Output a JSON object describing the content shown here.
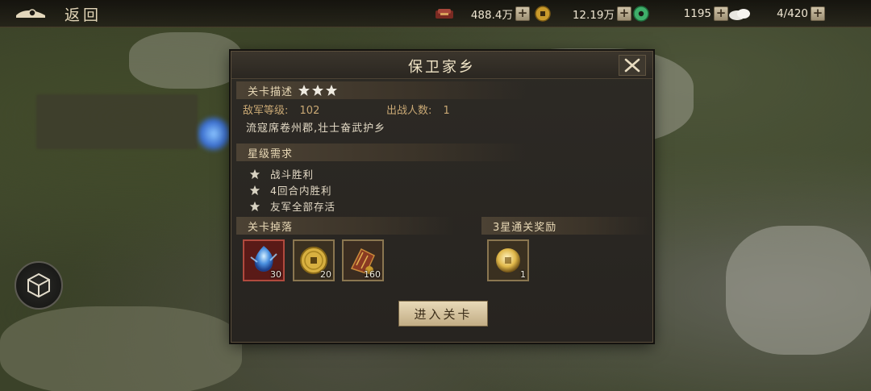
{
  "topbar": {
    "back_label": "返回",
    "resources": [
      {
        "icon": "silver-ingot-icon",
        "value": "488.4万"
      },
      {
        "icon": "copper-coin-icon",
        "value": "12.19万"
      },
      {
        "icon": "jade-disc-icon",
        "value": "1195"
      },
      {
        "icon": "troops-icon",
        "value": "4/420"
      }
    ],
    "plus": "+"
  },
  "dialog": {
    "title": "保卫家乡",
    "description": {
      "label": "关卡描述",
      "stars": 3,
      "enemy_level_label": "敌军等级:",
      "enemy_level": "102",
      "troops_label": "出战人数:",
      "troops": "1",
      "text": "流寇席卷州郡,壮士奋武护乡"
    },
    "star_requirements": {
      "label": "星级需求",
      "items": [
        "战斗胜利",
        "4回合内胜利",
        "友军全部存活"
      ]
    },
    "drops": {
      "label": "关卡掉落",
      "items": [
        {
          "icon": "blue-crystal-icon",
          "count": "30",
          "frame": "red"
        },
        {
          "icon": "gold-coin-icon",
          "count": "20",
          "frame": "gold"
        },
        {
          "icon": "treasure-bundle-icon",
          "count": "160",
          "frame": "gold"
        }
      ]
    },
    "three_star_reward": {
      "label": "3星通关奖励",
      "items": [
        {
          "icon": "gold-coin-icon",
          "count": "1",
          "frame": "gold"
        }
      ]
    },
    "enter_button": "进入关卡"
  },
  "colors": {
    "accent_gold": "#c9a874",
    "button_cream": "#e8d9b8",
    "panel_bg": "#2d2a25"
  }
}
